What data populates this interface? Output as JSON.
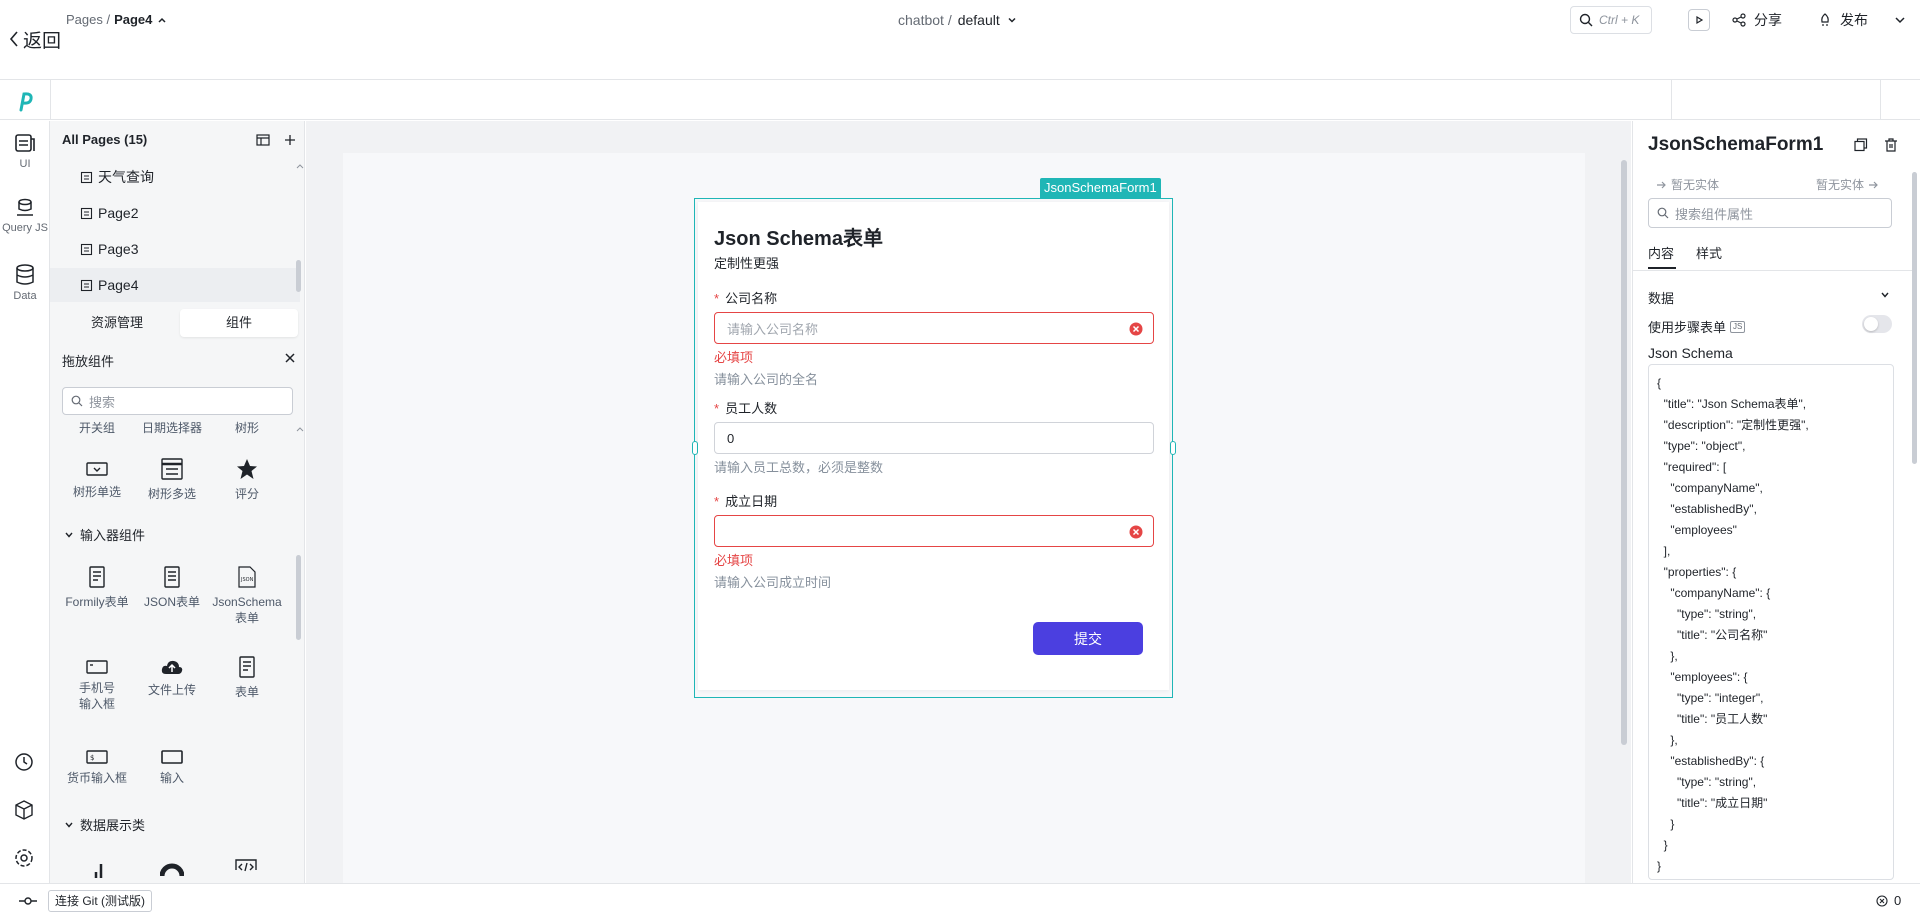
{
  "back": {
    "label": "返回"
  },
  "header": {
    "breadcrumb_root": "Pages /",
    "breadcrumb_current": "Page4",
    "app_name": "chatbot /",
    "env": "default",
    "search_shortcut": "Ctrl + K",
    "share_label": "分享",
    "publish_label": "发布"
  },
  "rail": {
    "items": [
      {
        "label": "UI",
        "icon": "ui-icon"
      },
      {
        "label": "Query JS",
        "icon": "database-icon"
      },
      {
        "label": "Data",
        "icon": "data-icon"
      }
    ]
  },
  "pages": {
    "title": "All Pages (15)",
    "items": [
      "天气查询",
      "Page2",
      "Page3",
      "Page4"
    ],
    "selected": "Page4"
  },
  "left_tabs": {
    "resources": "资源管理",
    "components": "组件"
  },
  "components_panel": {
    "title": "拖放组件",
    "search_placeholder": "搜索",
    "top_row": [
      "开关组",
      "日期选择器",
      "树形"
    ],
    "row1": [
      {
        "label": "树形单选",
        "icon": "tree-select-icon"
      },
      {
        "label": "树形多选",
        "icon": "tree-multi-select-icon"
      },
      {
        "label": "评分",
        "icon": "star-icon"
      }
    ],
    "group_input": "输入器组件",
    "row2": [
      {
        "label": "Formily表单",
        "icon": "form-icon"
      },
      {
        "label": "JSON表单",
        "icon": "json-form-icon"
      },
      {
        "label": "JsonSchema",
        "label2": "表单",
        "icon": "json-schema-icon"
      }
    ],
    "row3": [
      {
        "label": "手机号",
        "label2": "输入框",
        "icon": "phone-input-icon"
      },
      {
        "label": "文件上传",
        "icon": "upload-icon"
      },
      {
        "label": "表单",
        "icon": "form-icon"
      }
    ],
    "row4": [
      {
        "label": "货币输入框",
        "icon": "currency-input-icon"
      },
      {
        "label": "输入",
        "icon": "input-icon"
      }
    ],
    "group_display": "数据展示类"
  },
  "form": {
    "tag": "JsonSchemaForm1",
    "title": "Json Schema表单",
    "description": "定制性更强",
    "fields": [
      {
        "label": "公司名称",
        "placeholder": "请输入公司名称",
        "value": "",
        "error": "必填项",
        "help": "请输入公司的全名"
      },
      {
        "label": "员工人数",
        "placeholder": "",
        "value": "0",
        "error": "",
        "help": "请输入员工总数，必须是整数"
      },
      {
        "label": "成立日期",
        "placeholder": "",
        "value": "",
        "error": "必填项",
        "help": "请输入公司成立时间"
      }
    ],
    "submit_label": "提交"
  },
  "right_panel": {
    "title": "JsonSchemaForm1",
    "entity_left": "暂无实体",
    "entity_right": "暂无实体",
    "search_placeholder": "搜索组件属性",
    "tab_content": "内容",
    "tab_style": "样式",
    "section_data": "数据",
    "step_form_label": "使用步骤表单",
    "js_badge": "JS",
    "schema_label": "Json Schema",
    "schema_code": "{\n  \"title\": \"Json Schema表单\",\n  \"description\": \"定制性更强\",\n  \"type\": \"object\",\n  \"required\": [\n    \"companyName\",\n    \"establishedBy\",\n    \"employees\"\n  ],\n  \"properties\": {\n    \"companyName\": {\n      \"type\": \"string\",\n      \"title\": \"公司名称\"\n    },\n    \"employees\": {\n      \"type\": \"integer\",\n      \"title\": \"员工人数\"\n    },\n    \"establishedBy\": {\n      \"type\": \"string\",\n      \"title\": \"成立日期\"\n    }\n  }\n}"
  },
  "bottom": {
    "git_label": "连接 Git (测试版)",
    "error_count": "0"
  },
  "colors": {
    "accent": "#4b3fe0",
    "selection": "#1fb6b6",
    "error": "#e54545"
  }
}
